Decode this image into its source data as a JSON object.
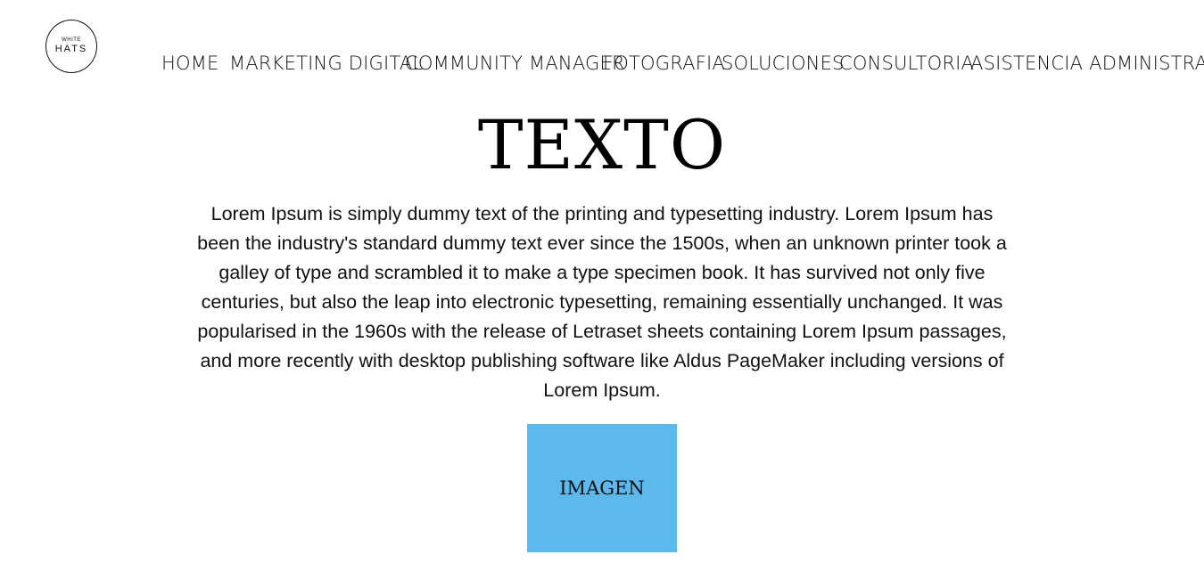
{
  "logo": {
    "small_text": "WHITE",
    "big_text": "HATS"
  },
  "nav": {
    "items": [
      {
        "label": "HOME"
      },
      {
        "label": "MARKETING DIGITAL"
      },
      {
        "label": "COMMUNITY MANAGER"
      },
      {
        "label": "FOTOGRAFIA"
      },
      {
        "label": "SOLUCIONES"
      },
      {
        "label": "CONSULTORIA"
      },
      {
        "label": "ASISTENCIA ADMINISTRATIVA"
      }
    ]
  },
  "main": {
    "title": "TEXTO",
    "paragraph": "Lorem Ipsum is simply dummy text of the printing and typesetting industry. Lorem Ipsum has been the industry's standard dummy text ever since the 1500s, when an unknown printer took a galley of type and scrambled it to make a type specimen book. It has survived not only five centuries, but also the leap into electronic typesetting, remaining essentially unchanged. It was popularised in the 1960s with the release of Letraset sheets containing Lorem Ipsum passages, and more recently with desktop publishing software like Aldus PageMaker including versions of Lorem Ipsum.",
    "image_label": "IMAGEN"
  },
  "colors": {
    "image_box": "#5DB9EB",
    "text": "#111111",
    "background": "#FFFFFF"
  }
}
